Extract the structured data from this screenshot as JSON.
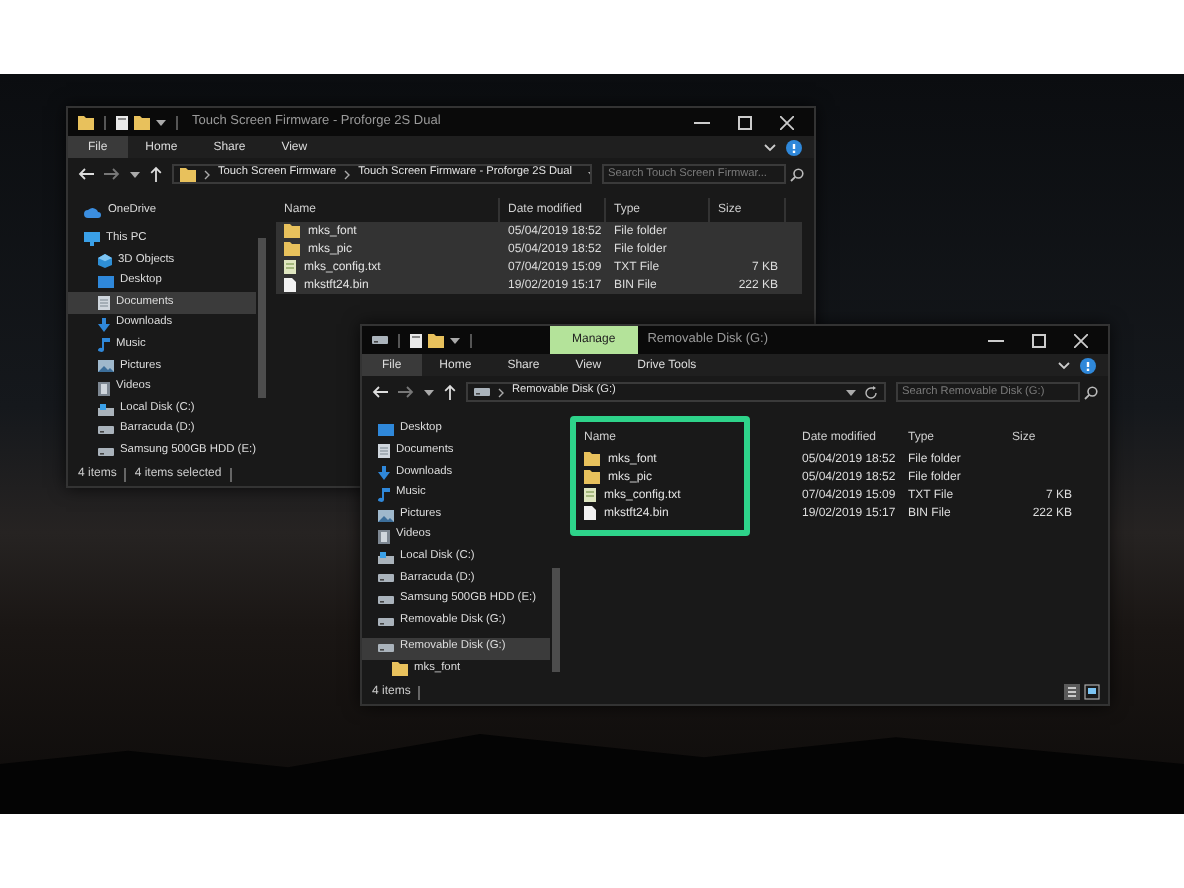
{
  "windows": [
    {
      "kind": "folder",
      "title": "Touch Screen Firmware - Proforge 2S Dual",
      "ribbon_tabs": [
        {
          "label": "File",
          "kind": "file"
        },
        {
          "label": "Home",
          "kind": "tab"
        },
        {
          "label": "Share",
          "kind": "tab"
        },
        {
          "label": "View",
          "kind": "tab"
        }
      ],
      "address": [
        "Touch Screen Firmware",
        "Touch Screen Firmware - Proforge 2S Dual"
      ],
      "search": {
        "placeholder": "Search Touch Screen Firmwar..."
      },
      "sidebar": [
        {
          "label": "OneDrive",
          "kind": "cloud",
          "selected": false
        },
        {
          "label": "This PC",
          "kind": "pc",
          "selected": false,
          "children": [
            {
              "label": "3D Objects",
              "kind": "cube",
              "selected": false
            },
            {
              "label": "Desktop",
              "kind": "desktop",
              "selected": false
            },
            {
              "label": "Documents",
              "kind": "documents",
              "selected": true
            },
            {
              "label": "Downloads",
              "kind": "downloads",
              "selected": false
            },
            {
              "label": "Music",
              "kind": "music",
              "selected": false
            },
            {
              "label": "Pictures",
              "kind": "pictures",
              "selected": false
            },
            {
              "label": "Videos",
              "kind": "videos",
              "selected": false
            },
            {
              "label": "Local Disk (C:)",
              "kind": "disk",
              "selected": false
            },
            {
              "label": "Barracuda (D:)",
              "kind": "drive",
              "selected": false
            },
            {
              "label": "Samsung 500GB HDD (E:)",
              "kind": "drive",
              "selected": false
            }
          ]
        }
      ],
      "columns": [
        "Name",
        "Date modified",
        "Type",
        "Size"
      ],
      "files": [
        {
          "name": "mks_font",
          "kind": "folder",
          "date": "05/04/2019 18:52",
          "type": "File folder",
          "selected": true
        },
        {
          "name": "mks_pic",
          "kind": "folder",
          "date": "05/04/2019 18:52",
          "type": "File folder",
          "selected": true
        },
        {
          "name": "mks_config.txt",
          "kind": "txt",
          "date": "07/04/2019 15:09",
          "type": "TXT File",
          "size": "7 KB",
          "selected": true
        },
        {
          "name": "mkstft24.bin",
          "kind": "bin",
          "date": "19/02/2019 15:17",
          "type": "BIN File",
          "size": "222 KB",
          "selected": true
        }
      ],
      "status": [
        "4 items",
        "4 items selected"
      ]
    },
    {
      "kind": "drive",
      "contextual_tab": "Manage",
      "title": "Removable Disk (G:)",
      "ribbon_tabs": [
        {
          "label": "File",
          "kind": "file"
        },
        {
          "label": "Home",
          "kind": "tab"
        },
        {
          "label": "Share",
          "kind": "tab"
        },
        {
          "label": "View",
          "kind": "tab"
        },
        {
          "label": "Drive Tools",
          "kind": "tab"
        }
      ],
      "address": [
        "Removable Disk (G:)"
      ],
      "search": {
        "placeholder": "Search Removable Disk (G:)"
      },
      "sidebar": [
        {
          "label": "Desktop",
          "kind": "desktop",
          "selected": false
        },
        {
          "label": "Documents",
          "kind": "documents",
          "selected": false
        },
        {
          "label": "Downloads",
          "kind": "downloads",
          "selected": false
        },
        {
          "label": "Music",
          "kind": "music",
          "selected": false
        },
        {
          "label": "Pictures",
          "kind": "pictures",
          "selected": false
        },
        {
          "label": "Videos",
          "kind": "videos",
          "selected": false
        },
        {
          "label": "Local Disk (C:)",
          "kind": "disk",
          "selected": false
        },
        {
          "label": "Barracuda (D:)",
          "kind": "drive",
          "selected": false
        },
        {
          "label": "Samsung 500GB HDD (E:)",
          "kind": "drive",
          "selected": false
        },
        {
          "label": "Removable Disk (G:)",
          "kind": "drive",
          "selected": false
        },
        {
          "label": "Removable Disk (G:)",
          "kind": "drive",
          "selected": true,
          "children": [
            {
              "label": "mks_font",
              "kind": "folder",
              "selected": false
            }
          ]
        }
      ],
      "columns": [
        "Name",
        "Date modified",
        "Type",
        "Size"
      ],
      "files": [
        {
          "name": "mks_font",
          "kind": "folder",
          "date": "05/04/2019 18:52",
          "type": "File folder",
          "selected": false
        },
        {
          "name": "mks_pic",
          "kind": "folder",
          "date": "05/04/2019 18:52",
          "type": "File folder",
          "selected": false
        },
        {
          "name": "mks_config.txt",
          "kind": "txt",
          "date": "07/04/2019 15:09",
          "type": "TXT File",
          "size": "7 KB",
          "selected": false
        },
        {
          "name": "mkstft24.bin",
          "kind": "bin",
          "date": "19/02/2019 15:17",
          "type": "BIN File",
          "size": "222 KB",
          "selected": false
        }
      ],
      "status": [
        "4 items"
      ],
      "view_buttons": true,
      "highlight_frame": true
    }
  ]
}
